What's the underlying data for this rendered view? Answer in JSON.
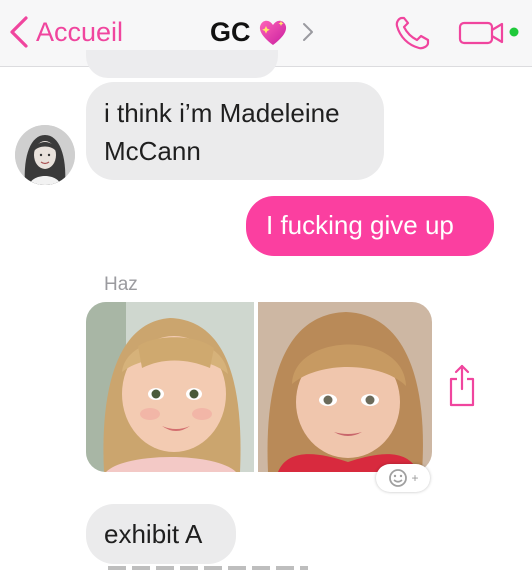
{
  "header": {
    "back_label": "Accueil",
    "title": "GC",
    "title_emoji": "sparkling-heart-icon"
  },
  "colors": {
    "accent": "#fb3fa0",
    "incoming_bubble": "#ebebec",
    "header_bg": "#f7f7f8",
    "status_dot": "#1fc93a"
  },
  "messages": [
    {
      "direction": "incoming",
      "text": "i think i’m Madeleine McCann"
    },
    {
      "direction": "outgoing",
      "text": "I fucking give up"
    },
    {
      "direction": "incoming",
      "sender": "Haz",
      "type": "photos",
      "count": 2
    },
    {
      "direction": "incoming",
      "text": "exhibit A"
    }
  ]
}
